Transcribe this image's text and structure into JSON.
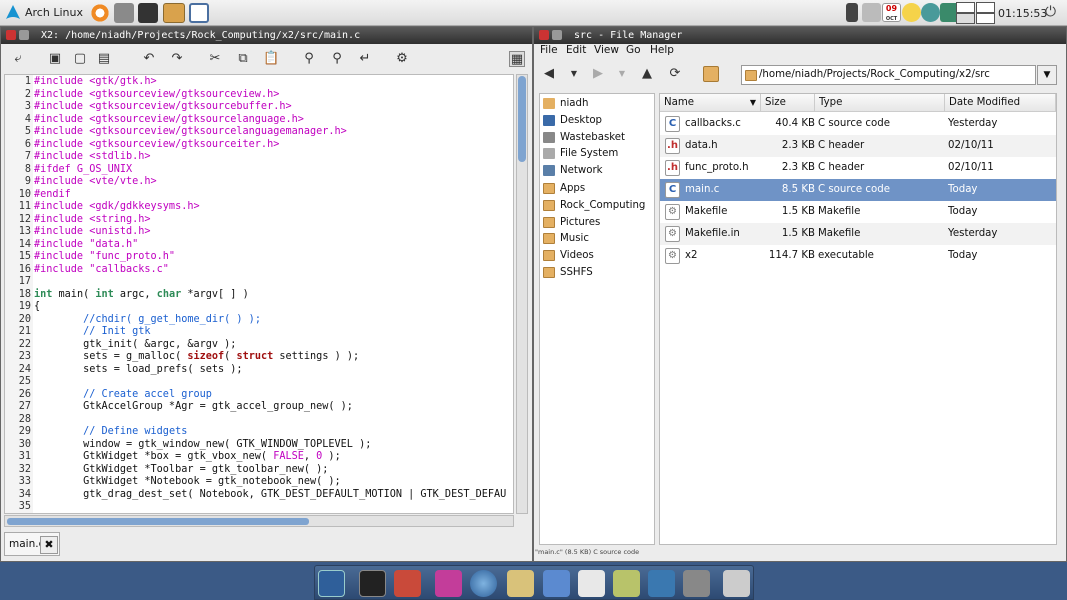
{
  "topbar": {
    "distro_label": "Arch Linux",
    "clock": "01:15:53",
    "calendar_day": "09",
    "calendar_month": "OCT"
  },
  "editor_window": {
    "title": "X2: /home/niadh/Projects/Rock_Computing/x2/src/main.c",
    "tab_label": "main.c",
    "tab_close": "✖",
    "lines": [
      {
        "n": "1",
        "html": "<span class=\"pp\">#include &lt;gtk/gtk.h&gt;</span>"
      },
      {
        "n": "2",
        "html": "<span class=\"pp\">#include &lt;gtksourceview/gtksourceview.h&gt;</span>"
      },
      {
        "n": "3",
        "html": "<span class=\"pp\">#include &lt;gtksourceview/gtksourcebuffer.h&gt;</span>"
      },
      {
        "n": "4",
        "html": "<span class=\"pp\">#include &lt;gtksourceview/gtksourcelanguage.h&gt;</span>"
      },
      {
        "n": "5",
        "html": "<span class=\"pp\">#include &lt;gtksourceview/gtksourcelanguagemanager.h&gt;</span>"
      },
      {
        "n": "6",
        "html": "<span class=\"pp\">#include &lt;gtksourceview/gtksourceiter.h&gt;</span>"
      },
      {
        "n": "7",
        "html": "<span class=\"pp\">#include &lt;stdlib.h&gt;</span>"
      },
      {
        "n": "8",
        "html": "<span class=\"pp\">#ifdef G_OS_UNIX</span>"
      },
      {
        "n": "9",
        "html": "<span class=\"pp\">#include &lt;vte/vte.h&gt;</span>"
      },
      {
        "n": "10",
        "html": "<span class=\"pp\">#endif</span>"
      },
      {
        "n": "11",
        "html": "<span class=\"pp\">#include &lt;gdk/gdkkeysyms.h&gt;</span>"
      },
      {
        "n": "12",
        "html": "<span class=\"pp\">#include &lt;string.h&gt;</span>"
      },
      {
        "n": "13",
        "html": "<span class=\"pp\">#include &lt;unistd.h&gt;</span>"
      },
      {
        "n": "14",
        "html": "<span class=\"pp\">#include \"data.h\"</span>"
      },
      {
        "n": "15",
        "html": "<span class=\"pp\">#include \"func_proto.h\"</span>"
      },
      {
        "n": "16",
        "html": "<span class=\"pp\">#include \"callbacks.c\"</span>"
      },
      {
        "n": "17",
        "html": ""
      },
      {
        "n": "18",
        "html": "<span class=\"kw\">int</span> main( <span class=\"kw\">int</span> argc, <span class=\"kw\">char</span> *argv[ ] )"
      },
      {
        "n": "19",
        "html": "{"
      },
      {
        "n": "20",
        "html": "        <span class=\"cm\">//chdir( g_get_home_dir( ) );</span>"
      },
      {
        "n": "21",
        "html": "        <span class=\"cm\">// Init gtk</span>"
      },
      {
        "n": "22",
        "html": "        gtk_init( &amp;argc, &amp;argv );"
      },
      {
        "n": "23",
        "html": "        sets = g_malloc( <span class=\"bk\">sizeof</span>( <span class=\"bk\">struct</span> settings ) );"
      },
      {
        "n": "24",
        "html": "        sets = load_prefs( sets );"
      },
      {
        "n": "25",
        "html": ""
      },
      {
        "n": "26",
        "html": "        <span class=\"cm\">// Create accel group</span>"
      },
      {
        "n": "27",
        "html": "        GtkAccelGroup *Agr = gtk_accel_group_new( );"
      },
      {
        "n": "28",
        "html": ""
      },
      {
        "n": "29",
        "html": "        <span class=\"cm\">// Define widgets</span>"
      },
      {
        "n": "30",
        "html": "        window = gtk_window_new( GTK_WINDOW_TOPLEVEL );"
      },
      {
        "n": "31",
        "html": "        GtkWidget *box = gtk_vbox_new( <span class=\"bool\">FALSE</span>, <span class=\"bool\">0</span> );"
      },
      {
        "n": "32",
        "html": "        GtkWidget *Toolbar = gtk_toolbar_new( );"
      },
      {
        "n": "33",
        "html": "        GtkWidget *Notebook = gtk_notebook_new( );"
      },
      {
        "n": "34",
        "html": "        gtk_drag_dest_set( Notebook, GTK_DEST_DEFAULT_MOTION | GTK_DEST_DEFAU"
      },
      {
        "n": "35",
        "html": ""
      }
    ]
  },
  "file_manager": {
    "title": "src - File Manager",
    "menu": [
      "File",
      "Edit",
      "View",
      "Go",
      "Help"
    ],
    "path": "/home/niadh/Projects/Rock_Computing/x2/src",
    "sidebar": [
      {
        "label": "niadh",
        "icon": "home-icon"
      },
      {
        "label": "Desktop",
        "icon": "desktop-icon"
      },
      {
        "label": "Wastebasket",
        "icon": "trash-icon"
      },
      {
        "label": "File System",
        "icon": "drive-icon"
      },
      {
        "label": "Network",
        "icon": "network-icon"
      },
      {
        "label": "Apps",
        "icon": "folder-icon"
      },
      {
        "label": "Rock_Computing",
        "icon": "folder-icon"
      },
      {
        "label": "Pictures",
        "icon": "folder-icon"
      },
      {
        "label": "Music",
        "icon": "folder-icon"
      },
      {
        "label": "Videos",
        "icon": "folder-icon"
      },
      {
        "label": "SSHFS",
        "icon": "folder-icon"
      }
    ],
    "columns": {
      "name": "Name",
      "size": "Size",
      "type": "Type",
      "modified": "Date Modified"
    },
    "files": [
      {
        "glyph": "C",
        "name": "callbacks.c",
        "size": "40.4 KB",
        "type": "C source code",
        "modified": "Yesterday"
      },
      {
        "glyph": ".h",
        "name": "data.h",
        "size": "2.3 KB",
        "type": "C header",
        "modified": "02/10/11"
      },
      {
        "glyph": ".h",
        "name": "func_proto.h",
        "size": "2.3 KB",
        "type": "C header",
        "modified": "02/10/11"
      },
      {
        "glyph": "C",
        "name": "main.c",
        "size": "8.5 KB",
        "type": "C source code",
        "modified": "Today"
      },
      {
        "glyph": "⚙",
        "name": "Makefile",
        "size": "1.5 KB",
        "type": "Makefile",
        "modified": "Today"
      },
      {
        "glyph": "⚙",
        "name": "Makefile.in",
        "size": "1.5 KB",
        "type": "Makefile",
        "modified": "Yesterday"
      },
      {
        "glyph": "⚙",
        "name": "x2",
        "size": "114.7 KB",
        "type": "executable",
        "modified": "Today"
      }
    ],
    "selected_index": 3,
    "status": "\"main.c\" (8.5 KB) C source code"
  },
  "colors": {
    "accent": "#6f93c6",
    "desktop": "#3b5a86",
    "preprocessor": "#c000c0",
    "comment": "#1a5fd0"
  }
}
